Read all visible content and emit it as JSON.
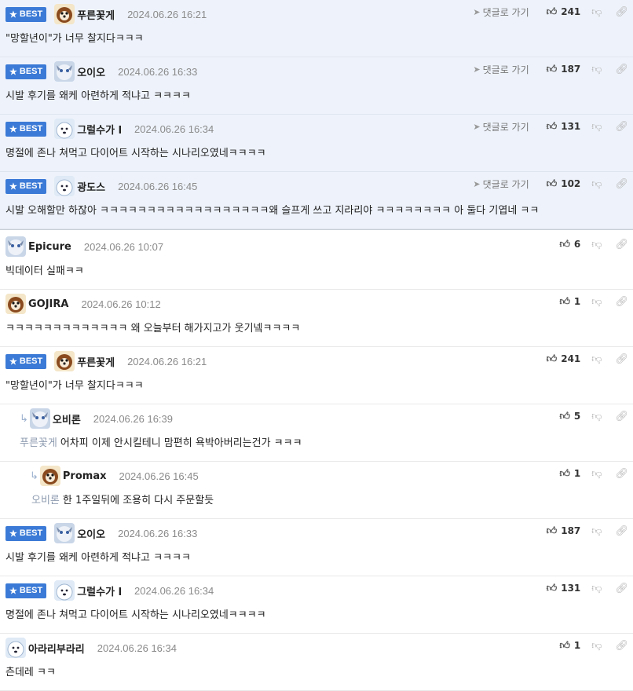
{
  "labels": {
    "best": "BEST",
    "goto_reply": "댓글로 가기"
  },
  "best_comments": [
    {
      "nick": "푸른꽃게",
      "date": "2024.06.26 16:21",
      "text": "\"망할년이\"가 너무 찰지다ㅋㅋㅋ",
      "likes": "241",
      "avatar": "dog-avatar"
    },
    {
      "nick": "오이오",
      "date": "2024.06.26 16:33",
      "text": "시발 후기를 왜케 아련하게 적냐고 ㅋㅋㅋㅋ",
      "likes": "187",
      "avatar": "cat-avatar"
    },
    {
      "nick": "그럴수가 l",
      "date": "2024.06.26 16:34",
      "text": "명절에 존나 쳐먹고 다이어트 시작하는 시나리오였네ㅋㅋㅋㅋ",
      "likes": "131",
      "avatar": "polar-avatar"
    },
    {
      "nick": "광도스",
      "date": "2024.06.26 16:45",
      "text": "시발 오해할만 하잖아 ㅋㅋㅋㅋㅋㅋㅋㅋㅋㅋㅋㅋㅋㅋㅋㅋㅋㅋ왜 슬프게 쓰고 지라리야 ㅋㅋㅋㅋㅋㅋㅋㅋ 아 둘다 기엽네 ㅋㅋ",
      "likes": "102",
      "avatar": "polar-avatar"
    }
  ],
  "comments": [
    {
      "nick": "Epicure",
      "date": "2024.06.26 10:07",
      "text": "빅데이터 실패ㅋㅋ",
      "likes": "6",
      "avatar": "cat-avatar"
    },
    {
      "nick": "GOJIRA",
      "date": "2024.06.26 10:12",
      "text": "ㅋㅋㅋㅋㅋㅋㅋㅋㅋㅋㅋㅋㅋ 왜 오늘부터 해가지고가 웃기넼ㅋㅋㅋㅋ",
      "likes": "1",
      "avatar": "dog-avatar"
    },
    {
      "nick": "푸른꽃게",
      "date": "2024.06.26 16:21",
      "text": "\"망할년이\"가 너무 찰지다ㅋㅋㅋ",
      "likes": "241",
      "avatar": "dog-avatar",
      "best": true
    },
    {
      "nick": "오비론",
      "date": "2024.06.26 16:39",
      "reply_to": "푸른꽃게",
      "text": "어차피 이제 안시킬테니 맘편히 욕박아버리는건가 ㅋㅋㅋ",
      "likes": "5",
      "avatar": "cat-avatar",
      "depth": 1
    },
    {
      "nick": "Promax",
      "date": "2024.06.26 16:45",
      "reply_to": "오비론",
      "text": "한 1주일뒤에 조용히 다시 주문할듯",
      "likes": "1",
      "avatar": "dog-avatar",
      "depth": 2
    },
    {
      "nick": "오이오",
      "date": "2024.06.26 16:33",
      "text": "시발 후기를 왜케 아련하게 적냐고 ㅋㅋㅋㅋ",
      "likes": "187",
      "avatar": "cat-avatar",
      "best": true
    },
    {
      "nick": "그럴수가 l",
      "date": "2024.06.26 16:34",
      "text": "명절에 존나 쳐먹고 다이어트 시작하는 시나리오였네ㅋㅋㅋㅋ",
      "likes": "131",
      "avatar": "polar-avatar",
      "best": true
    },
    {
      "nick": "아라리부라리",
      "date": "2024.06.26 16:34",
      "text": "츤데레 ㅋㅋ",
      "likes": "1",
      "avatar": "polar-avatar"
    }
  ],
  "colors": {
    "best_badge": "#3b7ad6",
    "pinned_bg": "#eef3fb",
    "date": "#8a8a8a"
  }
}
